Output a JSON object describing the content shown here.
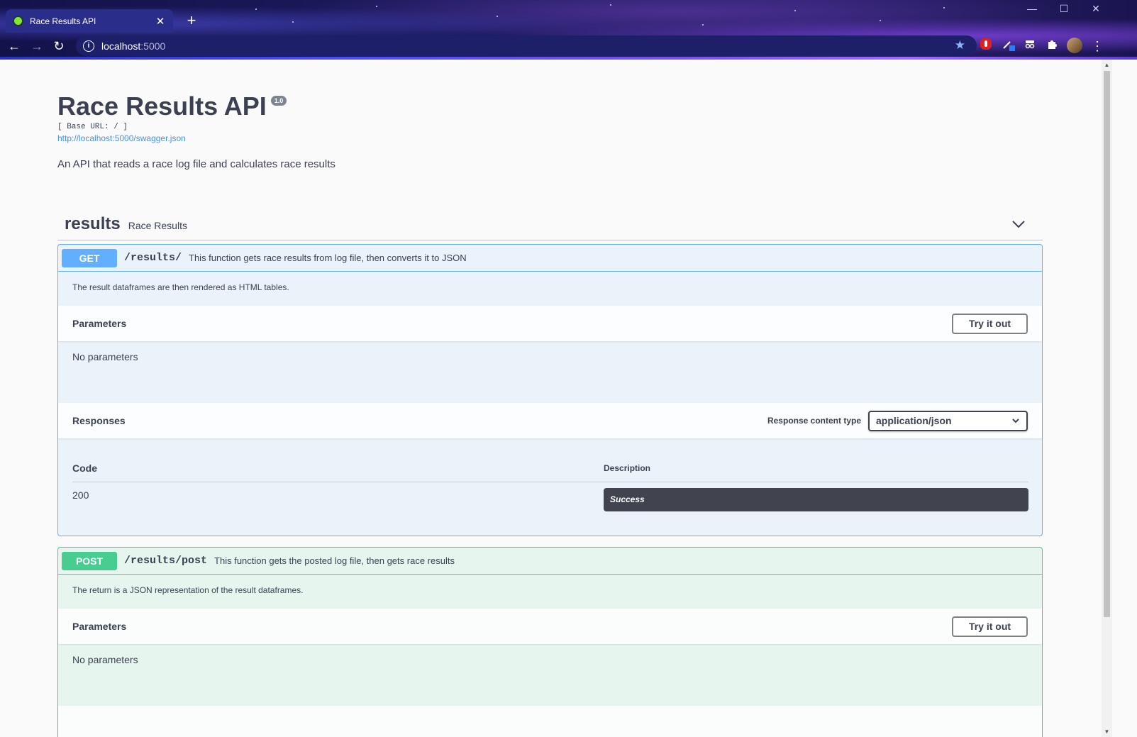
{
  "browser": {
    "tab_title": "Race Results API",
    "tab_close": "✕",
    "new_tab": "+",
    "window_controls": {
      "minimize": "—",
      "maximize": "☐",
      "close": "✕"
    },
    "nav": {
      "back": "←",
      "forward": "→",
      "reload": "↻",
      "menu": "⋮"
    },
    "address_host": "localhost",
    "address_port": ":5000",
    "bookmark_star": "★"
  },
  "info": {
    "title": "Race Results API",
    "version": "1.0",
    "base_url": "[ Base URL: / ]",
    "spec_link": "http://localhost:5000/swagger.json",
    "description": "An API that reads a race log file and calculates race results"
  },
  "tag": {
    "name": "results",
    "description": "Race Results"
  },
  "operations": [
    {
      "method": "GET",
      "path": "/results/",
      "summary": "This function gets race results from log file, then converts it to JSON",
      "description": "The result dataframes are then rendered as HTML tables.",
      "parameters_title": "Parameters",
      "try_it_out": "Try it out",
      "no_parameters": "No parameters",
      "responses_title": "Responses",
      "response_content_type_label": "Response content type",
      "response_content_type": "application/json",
      "table": {
        "code_header": "Code",
        "description_header": "Description",
        "rows": [
          {
            "code": "200",
            "description": "Success"
          }
        ]
      }
    },
    {
      "method": "POST",
      "path": "/results/post",
      "summary": "This function gets the posted log file, then gets race results",
      "description": "The return is a JSON representation of the result dataframes.",
      "parameters_title": "Parameters",
      "try_it_out": "Try it out",
      "no_parameters": "No parameters"
    }
  ],
  "colors": {
    "get": "#61affe",
    "post": "#49cc90",
    "text": "#3b4151",
    "link": "#4990e2"
  }
}
